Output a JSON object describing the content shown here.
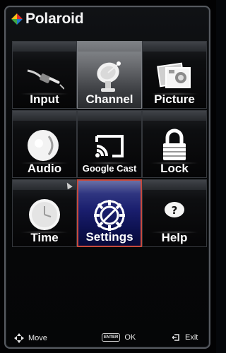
{
  "brand": {
    "name": "Polaroid"
  },
  "menu": {
    "tiles": [
      {
        "label": "Input",
        "icon": "input-cable-icon"
      },
      {
        "label": "Channel",
        "icon": "satellite-dish-icon"
      },
      {
        "label": "Picture",
        "icon": "picture-icon"
      },
      {
        "label": "Audio",
        "icon": "audio-speaker-icon"
      },
      {
        "label": "Google Cast",
        "icon": "cast-icon"
      },
      {
        "label": "Lock",
        "icon": "padlock-icon"
      },
      {
        "label": "Time",
        "icon": "clock-icon"
      },
      {
        "label": "Settings",
        "icon": "settings-gear-icon"
      },
      {
        "label": "Help",
        "icon": "help-icon"
      }
    ],
    "selected": "Settings"
  },
  "footer": {
    "move_label": "Move",
    "enter_key": "ENTER",
    "ok_label": "OK",
    "exit_label": "Exit"
  },
  "colors": {
    "selection_border": "#c84a3c",
    "selected_tile": "#1a1e6e",
    "logo_red": "#e2312d",
    "logo_yellow": "#f6c218",
    "logo_green": "#3fa845",
    "logo_blue": "#1f78c8"
  }
}
